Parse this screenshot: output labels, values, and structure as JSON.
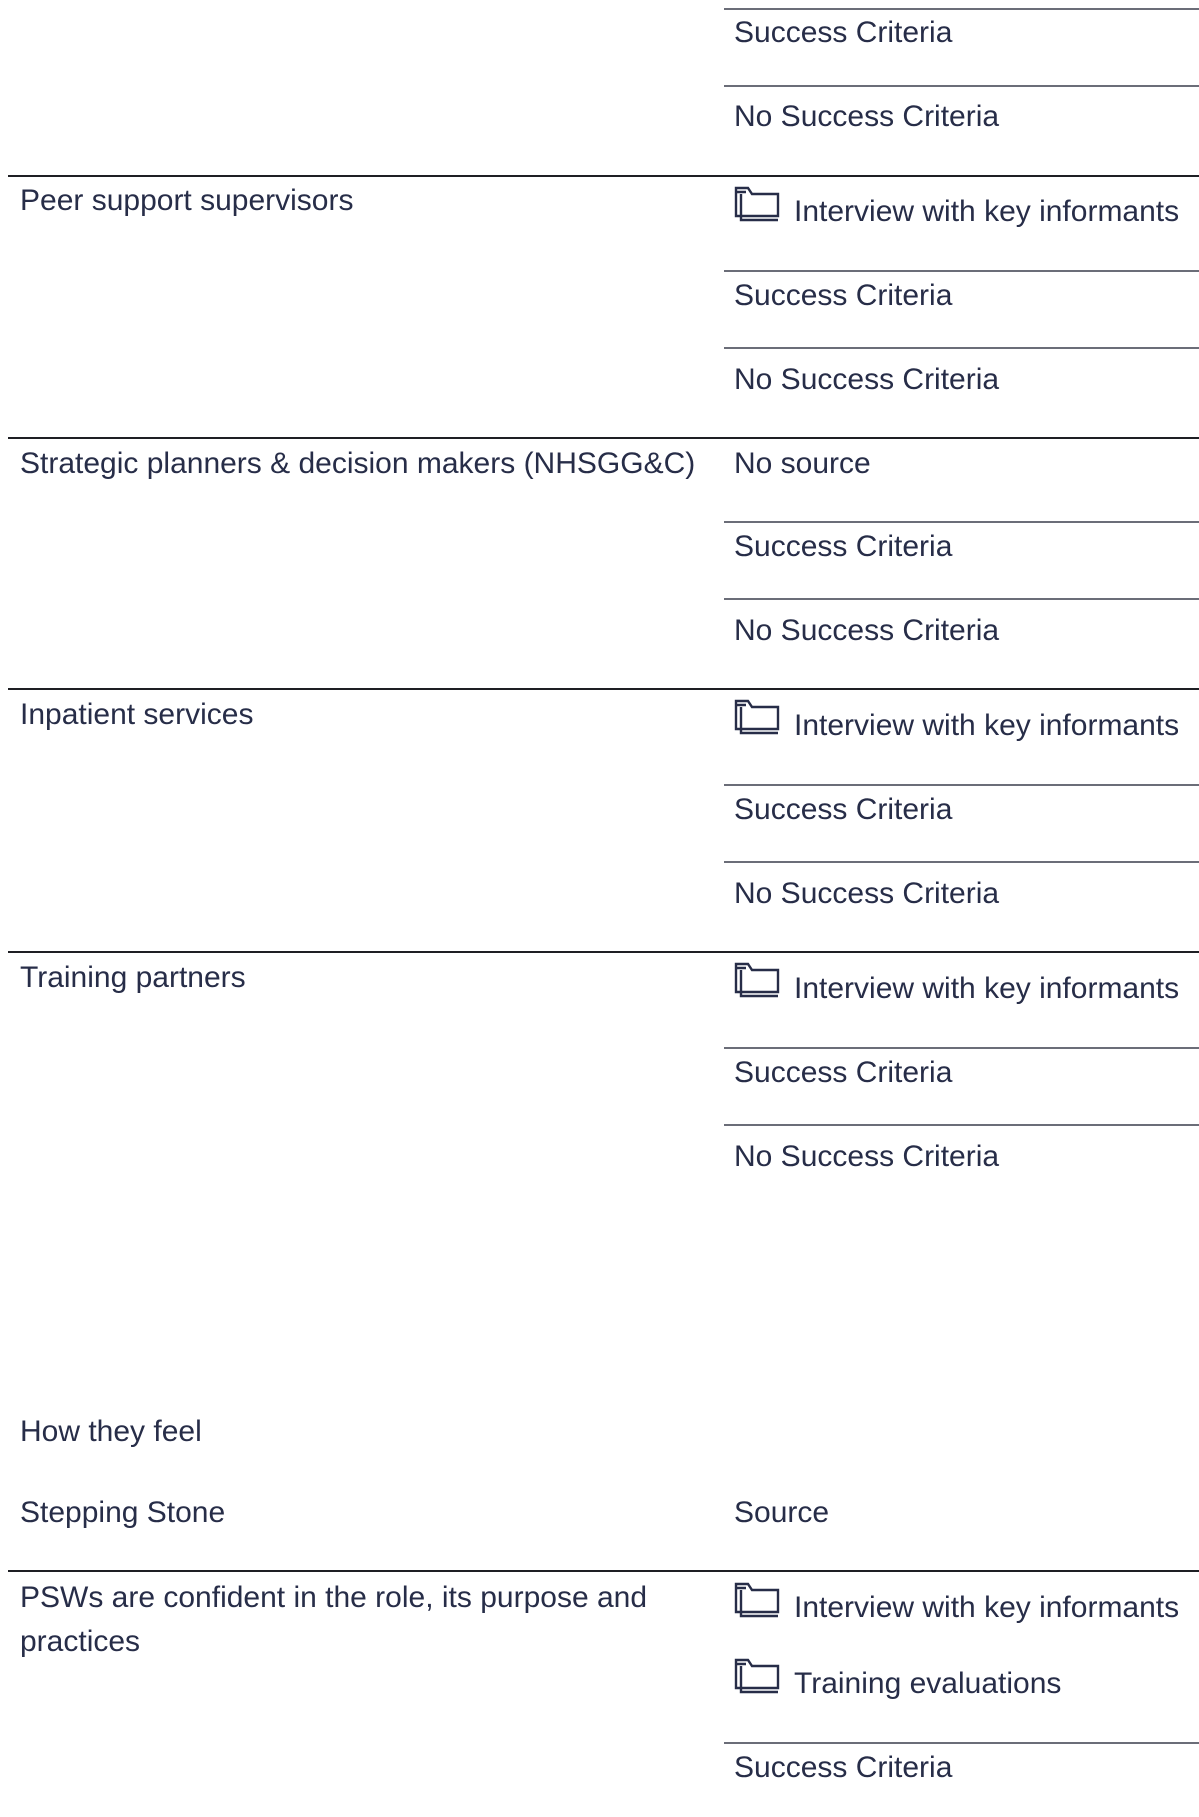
{
  "top_block": {
    "success_label": "Success Criteria",
    "no_success": "No Success Criteria"
  },
  "rows": [
    {
      "stakeholder": "Peer support supervisors",
      "source": "Interview with key informants",
      "success_label": "Success Criteria",
      "no_success": "No Success Criteria"
    },
    {
      "stakeholder": "Strategic planners & decision makers (NHSGG&C)",
      "source": "No source",
      "success_label": "Success Criteria",
      "no_success": "No Success Criteria"
    },
    {
      "stakeholder": "Inpatient services",
      "source": "Interview with key informants",
      "success_label": "Success Criteria",
      "no_success": "No Success Criteria"
    },
    {
      "stakeholder": "Training partners",
      "source": "Interview with key informants",
      "success_label": "Success Criteria",
      "no_success": "No Success Criteria"
    }
  ],
  "section2": {
    "title": "How they feel",
    "col_stepping_stone": "Stepping Stone",
    "col_source": "Source",
    "row": {
      "stepping_stone": "PSWs are confident in the role, its purpose and practices",
      "sources": [
        "Interview with key informants",
        "Training evaluations"
      ],
      "success_label": "Success Criteria"
    }
  },
  "colors": {
    "text": "#272d48",
    "rule_dark": "#1e1f24",
    "rule_light": "#6b6d78"
  }
}
